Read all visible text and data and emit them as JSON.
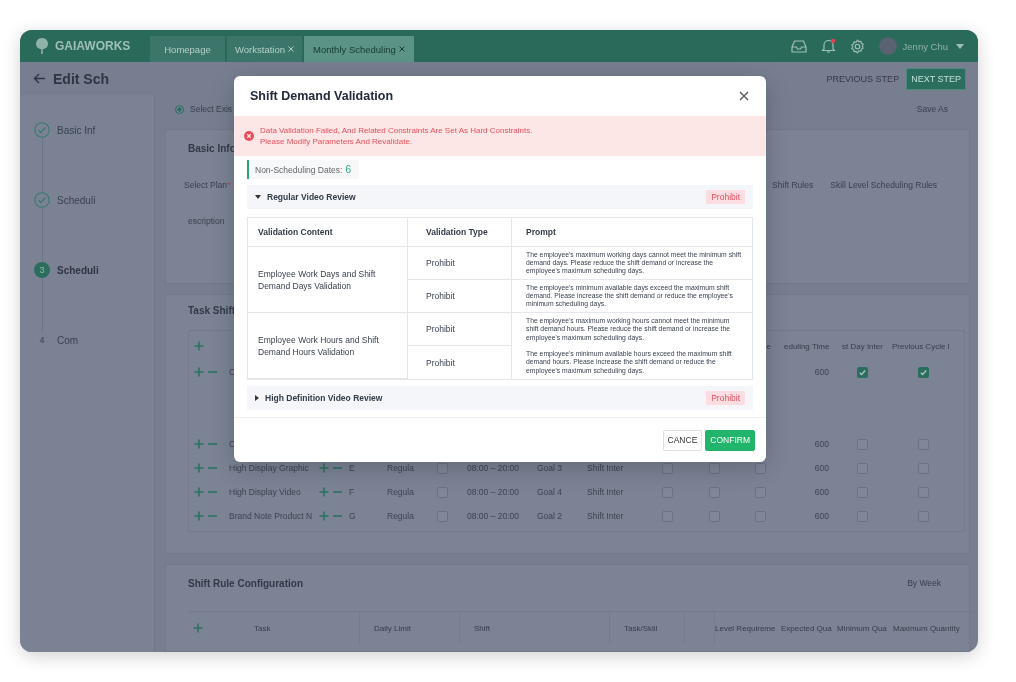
{
  "topbar": {
    "logo": "GAIAWORKS",
    "tabs": [
      {
        "label": "Homepage",
        "closable": false,
        "selected": false
      },
      {
        "label": "Workstation",
        "closable": true,
        "selected": false
      },
      {
        "label": "Monthly Scheduling",
        "closable": true,
        "selected": true
      }
    ],
    "notification": true,
    "user": "Jenny Chu"
  },
  "header": {
    "title": "Edit Sch",
    "buttons": [
      {
        "label": "PREVIOUS STEP",
        "kind": "secondary"
      },
      {
        "label": "NEXT STEP",
        "kind": "primary"
      }
    ]
  },
  "steps": [
    {
      "label": "Basic Inf",
      "completed": true,
      "active": false
    },
    {
      "label": "Scheduli",
      "completed": true,
      "active": false
    },
    {
      "number": "3",
      "label": "Scheduli",
      "completed": false,
      "active": true
    },
    {
      "number": "4",
      "label": "Com",
      "completed": false,
      "active": false
    }
  ],
  "plan_source": {
    "label": "Select Exis",
    "selected": true
  },
  "save_as": "Save As",
  "basic_info": {
    "title": "Basic Info",
    "select_plan": {
      "label": "Select Plan",
      "required_mark": "*"
    },
    "description_label": "escription",
    "rule_tabs": [
      "Shift Rules",
      "Skill Level Scheduling Rules"
    ]
  },
  "task_shift": {
    "title": "Task Shift",
    "headers": [
      "e",
      "eduling Time",
      "st Day Inter",
      "Previous Cycle I"
    ],
    "rows": [
      {
        "name": "C",
        "value": "600",
        "tail_checks": [
          {
            "checked": true
          },
          {
            "checked": true
          }
        ]
      },
      {
        "name": "C",
        "value": "600",
        "tail_checks": [
          {
            "checked": false
          },
          {
            "checked": false
          }
        ]
      },
      {
        "name": "High Display Graphic",
        "code": "E",
        "type": "Regula",
        "lead_check": {
          "checked": false
        },
        "time": "08:00 – 20:00",
        "goal": "Goal 3",
        "shift": "Shift Inter",
        "mid_checks": [
          {
            "checked": false
          },
          {
            "checked": false
          },
          {
            "checked": false
          }
        ],
        "value": "600",
        "tail_checks": [
          {
            "checked": false
          },
          {
            "checked": false
          }
        ]
      },
      {
        "name": "High Display Video",
        "code": "F",
        "type": "Regula",
        "lead_check": {
          "checked": false
        },
        "time": "08:00 – 20:00",
        "goal": "Goal 4",
        "shift": "Shift Inter",
        "mid_checks": [
          {
            "checked": false
          },
          {
            "checked": false
          },
          {
            "checked": false
          }
        ],
        "value": "600",
        "tail_checks": [
          {
            "checked": false
          },
          {
            "checked": false
          }
        ]
      },
      {
        "name": "Brand Note Product N",
        "code": "G",
        "type": "Regula",
        "lead_check": {
          "checked": false
        },
        "time": "08:00 – 20:00",
        "goal": "Goal 2",
        "shift": "Shift Inter",
        "mid_checks": [
          {
            "checked": false
          },
          {
            "checked": false
          },
          {
            "checked": false
          }
        ],
        "value": "600",
        "tail_checks": [
          {
            "checked": false
          },
          {
            "checked": false
          }
        ]
      }
    ]
  },
  "shift_rules": {
    "title": "Shift Rule Configuration",
    "period": "By Week",
    "columns": [
      "Task",
      "Daily Limit",
      "Shift",
      "Task/Skill",
      "Level Requireme",
      "Expected Qua",
      "Minimum Qua",
      "Maximum Quantity"
    ]
  },
  "dialog": {
    "title": "Shift Demand Validation",
    "alert": [
      "Data Validation Failed, And Related Constraints Are Set As Hard Constraints.",
      "Please Modify Parameters And Revalidate."
    ],
    "dates": {
      "label": "Non-Scheduling Dates:",
      "value": "6"
    },
    "groups": [
      {
        "name": "Regular Video Review",
        "expanded": true,
        "tag": "Prohibit",
        "columns": [
          "Validation Content",
          "Validation Type",
          "Prompt"
        ],
        "validations": [
          {
            "content": "Employee Work Days and Shift Demand Days Validation",
            "checks": [
              {
                "type": "Prohibit",
                "prompt": "The employee's maximum working days cannot meet the minimum shift demand days. Please reduce the shift demand or increase the employee's maximum scheduling days."
              },
              {
                "type": "Prohibit",
                "prompt": "The employee's minimum available days exceed the maximum shift demand. Please increase the shift demand or reduce the employee's minimum scheduling days."
              }
            ]
          },
          {
            "content": "Employee Work Hours and Shift Demand Hours Validation",
            "checks": [
              {
                "type": "Prohibit",
                "prompt": "The employee's maximum working hours cannot meet the minimum shift demand hours. Please reduce the shift demand or increase the employee's maximum scheduling days."
              },
              {
                "type": "Prohibit",
                "prompt": "The employee's minimum available hours exceed the maximum shift demand hours. Please increase the shift demand or reduce the employee's maximum scheduling days."
              }
            ]
          }
        ]
      },
      {
        "name": "High Definition Video Review",
        "expanded": false,
        "tag": "Prohibit"
      }
    ],
    "buttons": [
      {
        "label": "CANCE",
        "kind": "secondary"
      },
      {
        "label": "CONFIRM",
        "kind": "primary"
      }
    ]
  }
}
